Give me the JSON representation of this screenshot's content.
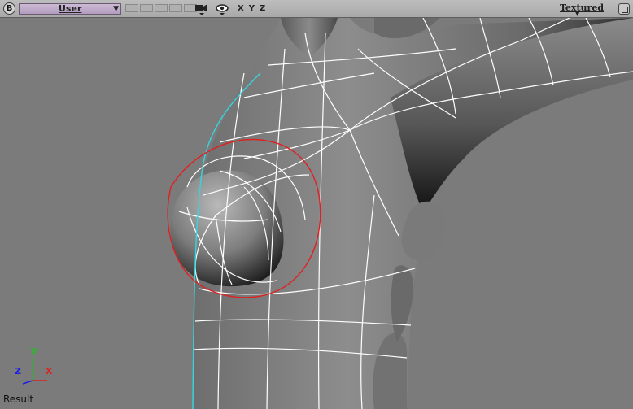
{
  "toolbar": {
    "logo": "B",
    "view_select": "User",
    "view_select_arrow": "▼",
    "axes": [
      "X",
      "Y",
      "Z"
    ],
    "shading_mode": "Textured",
    "icons": [
      "blender-logo-icon",
      "camera-view-icon",
      "eye-visibility-icon",
      "maximize-view-icon"
    ]
  },
  "viewport": {
    "status_label": "Result",
    "gizmo": {
      "y": "Y",
      "x": "X",
      "z": "Z"
    },
    "colors": {
      "background": "#7b7b7b",
      "wire": "#ffffff",
      "selection_outline": "#e02020",
      "silhouette_edge": "#33d6e0",
      "gizmo_y": "#20c020",
      "gizmo_x": "#e02020",
      "gizmo_z": "#2020e0"
    }
  }
}
